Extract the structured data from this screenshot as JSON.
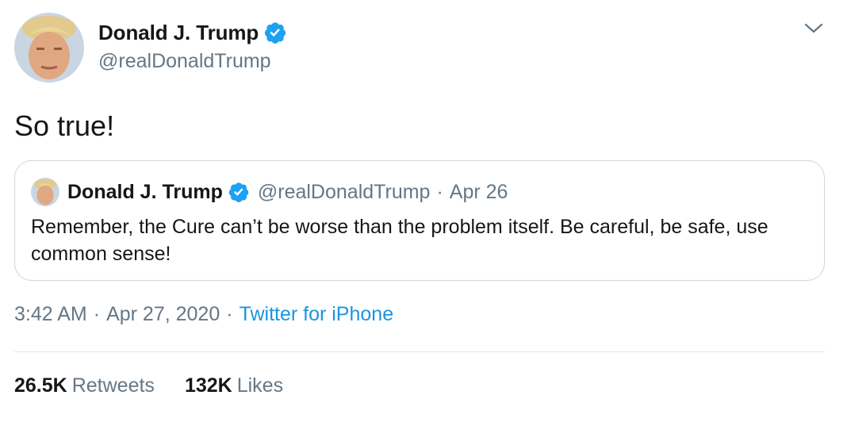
{
  "tweet": {
    "author": {
      "name": "Donald J. Trump",
      "handle": "@realDonaldTrump",
      "verified": true
    },
    "text": "So true!",
    "quoted": {
      "author_name": "Donald J. Trump",
      "handle": "@realDonaldTrump",
      "separator": "·",
      "date": "Apr 26",
      "text": "Remember, the Cure can’t be worse than the problem itself. Be careful, be safe, use common sense!"
    },
    "meta": {
      "time": "3:42 AM",
      "separator": "·",
      "date": "Apr 27, 2020",
      "source": "Twitter for iPhone"
    },
    "stats": {
      "retweets_count": "26.5K",
      "retweets_label": "Retweets",
      "likes_count": "132K",
      "likes_label": "Likes"
    }
  },
  "icons": {
    "verified": "verified-badge-icon",
    "menu": "chevron-down-icon"
  },
  "colors": {
    "text": "#14171a",
    "secondary": "#657786",
    "link": "#1b95e0",
    "verified": "#1da1f2",
    "border": "#ccd6dd"
  }
}
